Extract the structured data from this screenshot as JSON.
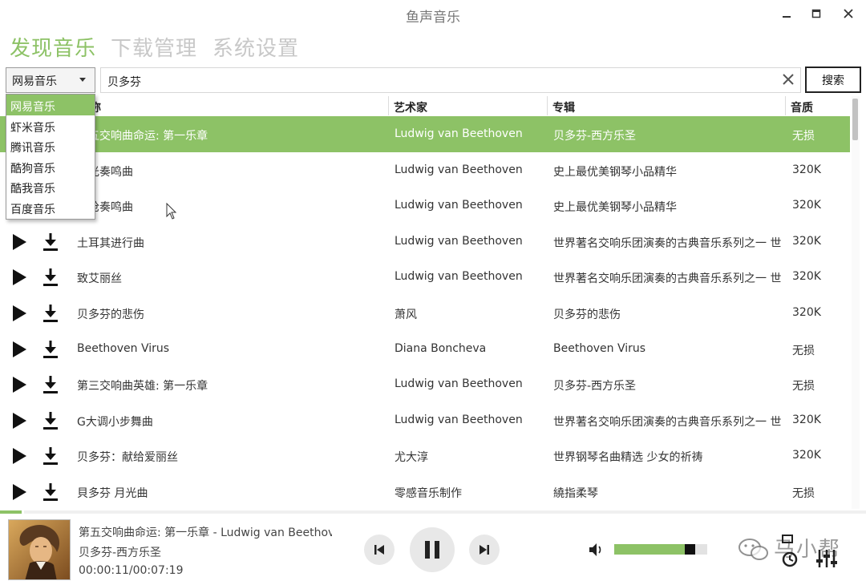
{
  "app": {
    "title": "鱼声音乐"
  },
  "window_controls": {
    "minimize": "minimize",
    "maximize": "maximize",
    "close": "close"
  },
  "nav": {
    "tabs": [
      {
        "label": "发现音乐",
        "active": true
      },
      {
        "label": "下载管理",
        "active": false
      },
      {
        "label": "系统设置",
        "active": false
      }
    ]
  },
  "search": {
    "source_selected": "网易音乐",
    "query": "贝多芬",
    "button_label": "搜索"
  },
  "source_dropdown": {
    "options": [
      "网易音乐",
      "虾米音乐",
      "腾讯音乐",
      "酷狗音乐",
      "酷我音乐",
      "百度音乐"
    ],
    "selected_index": 0
  },
  "table": {
    "columns": {
      "title": "名称",
      "artist": "艺术家",
      "album": "专辑",
      "quality": "音质"
    },
    "rows": [
      {
        "title": "第五交响曲命运: 第一乐章",
        "artist": "Ludwig van Beethoven",
        "album": "贝多芬-西方乐圣",
        "quality": "无损"
      },
      {
        "title": "月光奏鸣曲",
        "artist": "Ludwig van Beethoven",
        "album": "史上最优美钢琴小品精华",
        "quality": "320K"
      },
      {
        "title": "悲怆奏鸣曲",
        "artist": "Ludwig van Beethoven",
        "album": "史上最优美钢琴小品精华",
        "quality": "320K"
      },
      {
        "title": "土耳其进行曲",
        "artist": "Ludwig van Beethoven",
        "album": "世界著名交响乐团演奏的古典音乐系列之一 世",
        "quality": "320K"
      },
      {
        "title": "致艾丽丝",
        "artist": "Ludwig van Beethoven",
        "album": "世界著名交响乐团演奏的古典音乐系列之一 世",
        "quality": "320K"
      },
      {
        "title": "贝多芬的悲伤",
        "artist": "萧风",
        "album": "贝多芬的悲伤",
        "quality": "320K"
      },
      {
        "title": "Beethoven Virus",
        "artist": "Diana Boncheva",
        "album": "Beethoven Virus",
        "quality": "无损"
      },
      {
        "title": "第三交响曲英雄: 第一乐章",
        "artist": "Ludwig van Beethoven",
        "album": "贝多芬-西方乐圣",
        "quality": "无损"
      },
      {
        "title": "G大调小步舞曲",
        "artist": "Ludwig van Beethoven",
        "album": "世界著名交响乐团演奏的古典音乐系列之一 世",
        "quality": "320K"
      },
      {
        "title": "贝多芬：献给爱丽丝",
        "artist": "尤大淳",
        "album": "世界钢琴名曲精选 少女的祈祷",
        "quality": "320K"
      },
      {
        "title": "貝多芬 月光曲",
        "artist": "零感音乐制作",
        "album": "繞指柔琴",
        "quality": "无损"
      }
    ],
    "selected_index": 0
  },
  "player": {
    "now_playing": "第五交响曲命运: 第一乐章 - Ludwig van Beethoven",
    "album": "贝多芬-西方乐圣",
    "time": "00:00:11/00:07:19",
    "progress_fraction": 0.025,
    "volume_fraction": 0.82,
    "state": "playing"
  },
  "watermark": {
    "text": "马小帮"
  },
  "colors": {
    "accent": "#8dc266",
    "text": "#333333",
    "muted": "#c8c8c8"
  },
  "icons": [
    "play-icon",
    "download-icon",
    "previous-icon",
    "pause-icon",
    "next-icon",
    "volume-icon",
    "clear-icon",
    "timer-icon",
    "equalizer-icon"
  ]
}
